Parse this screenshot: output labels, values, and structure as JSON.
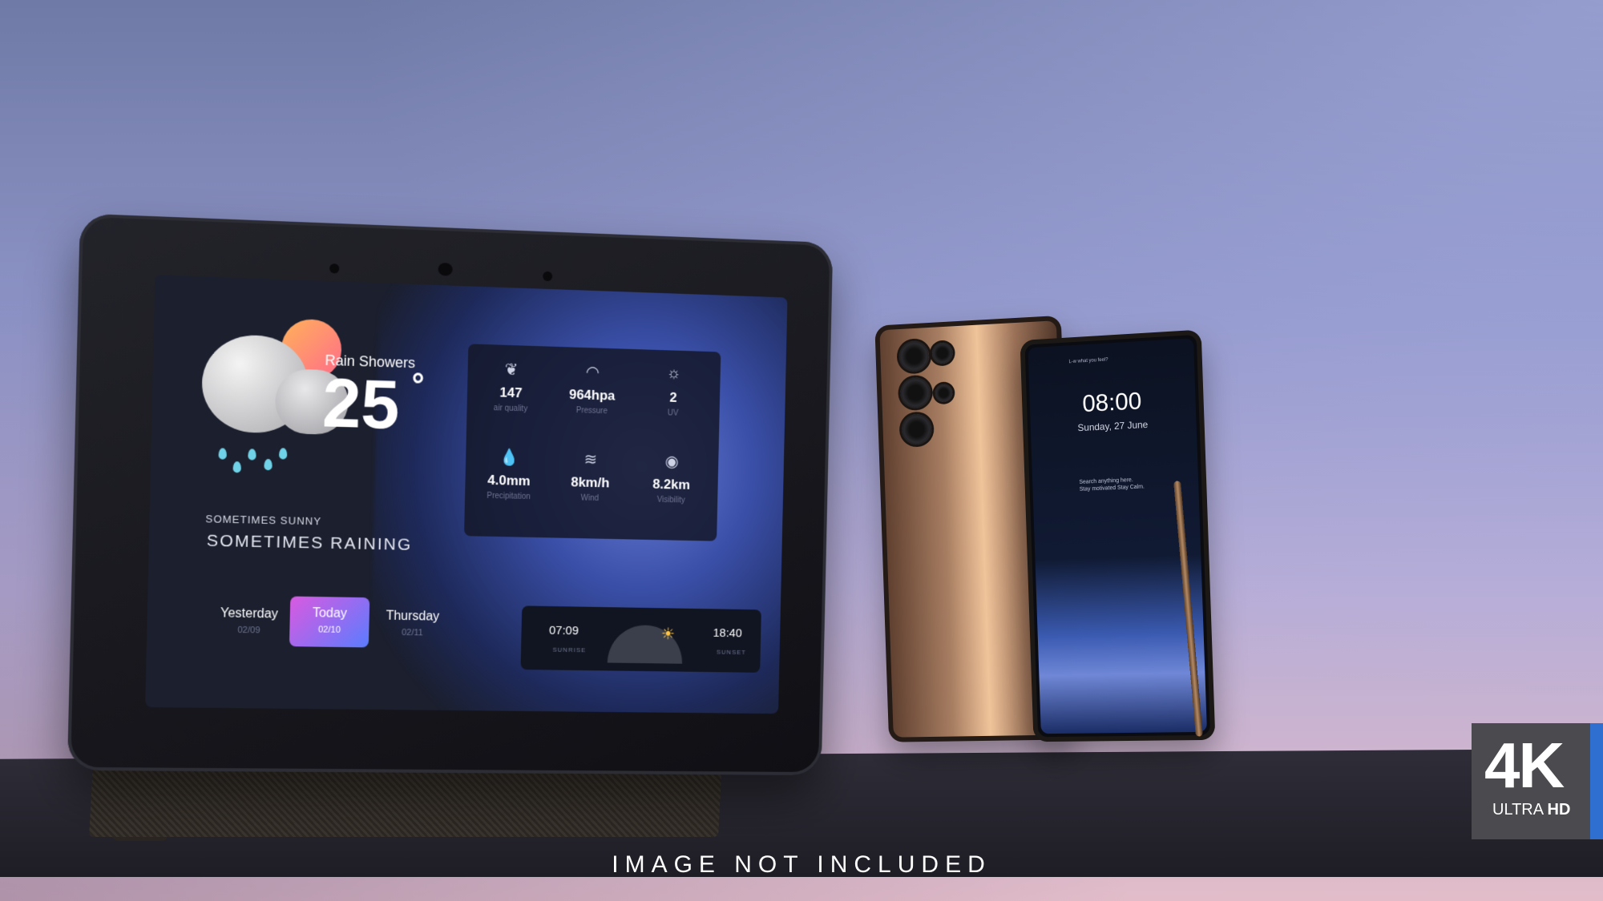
{
  "weather": {
    "condition": "Rain Showers",
    "temperature": "25",
    "degree_symbol": "°",
    "subtitle_small": "SOMETIMES SUNNY",
    "subtitle_large": "SOMETIMES RAINING",
    "stats": [
      {
        "icon": "leaf-icon",
        "value": "147",
        "label": "air quality"
      },
      {
        "icon": "gauge-icon",
        "value": "964hpa",
        "label": "Pressure"
      },
      {
        "icon": "sun-icon",
        "value": "2",
        "label": "UV"
      },
      {
        "icon": "droplet-icon",
        "value": "4.0mm",
        "label": "Precipitation"
      },
      {
        "icon": "wind-icon",
        "value": "8km/h",
        "label": "Wind"
      },
      {
        "icon": "eye-icon",
        "value": "8.2km",
        "label": "Visibility"
      }
    ],
    "days": [
      {
        "day": "Yesterday",
        "date": "02/09"
      },
      {
        "day": "Today",
        "date": "02/10"
      },
      {
        "day": "Thursday",
        "date": "02/11"
      }
    ],
    "sunrise_time": "07:09",
    "sunrise_label": "SUNRISE",
    "sunset_time": "18:40",
    "sunset_label": "SUNSET"
  },
  "phone": {
    "top_text": "L-w what you feel?",
    "time": "08:00",
    "date": "Sunday, 27 June",
    "hint_line1": "Search anything here.",
    "hint_line2": "Stay motivated Stay Calm."
  },
  "caption": "IMAGE NOT INCLUDED",
  "badge": {
    "big": "4K",
    "ultra": "ULTRA",
    "hd": "HD",
    "stripe_color": "#2f6fd0"
  }
}
